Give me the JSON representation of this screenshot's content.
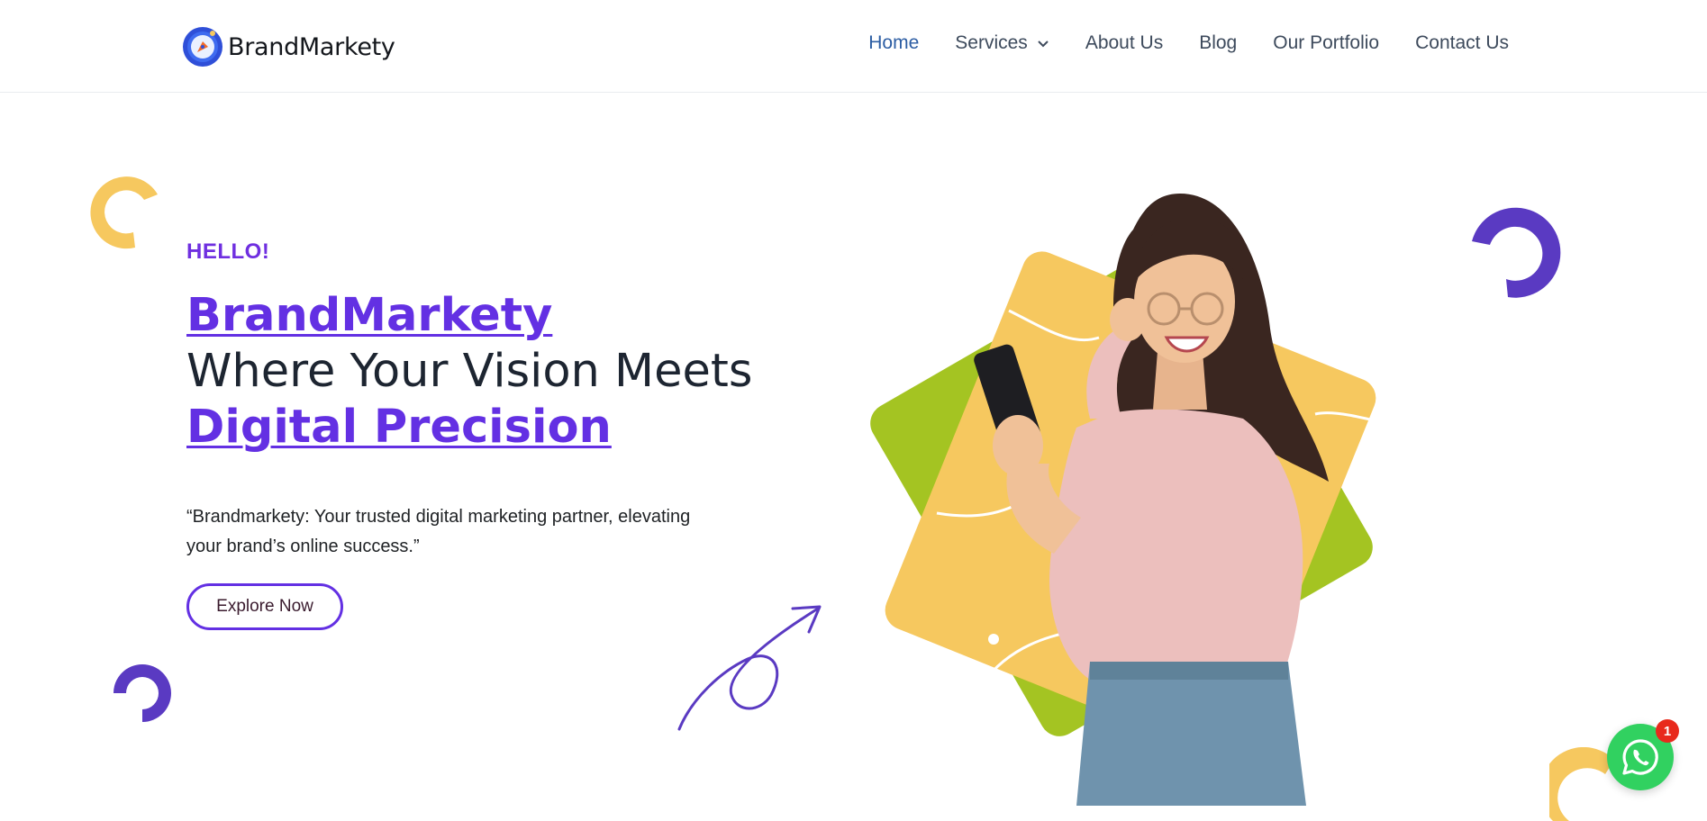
{
  "brand": {
    "name": "BrandMarkety"
  },
  "nav": {
    "items": [
      {
        "label": "Home",
        "active": true
      },
      {
        "label": "Services",
        "has_dropdown": true
      },
      {
        "label": "About Us"
      },
      {
        "label": "Blog"
      },
      {
        "label": "Our Portfolio"
      },
      {
        "label": "Contact Us"
      }
    ]
  },
  "hero": {
    "greeting": "HELLO!",
    "headline_line1": "BrandMarkety",
    "headline_line2": "Where Your Vision Meets",
    "headline_line3": "Digital Precision",
    "tagline": "“Brandmarkety: Your trusted digital marketing partner, elevating your brand’s online success.”",
    "cta_label": "Explore Now"
  },
  "whatsapp": {
    "badge_count": "1"
  },
  "colors": {
    "accent": "#6330e3",
    "nav_active": "#2c5da3",
    "yellow": "#f6c85f",
    "green": "#a4c422",
    "purple": "#5a3ac2",
    "whatsapp": "#31d160",
    "badge": "#e8291c"
  },
  "icons": [
    "logo-compass-icon",
    "chevron-down-icon",
    "arrow-swirl-icon",
    "whatsapp-icon"
  ]
}
